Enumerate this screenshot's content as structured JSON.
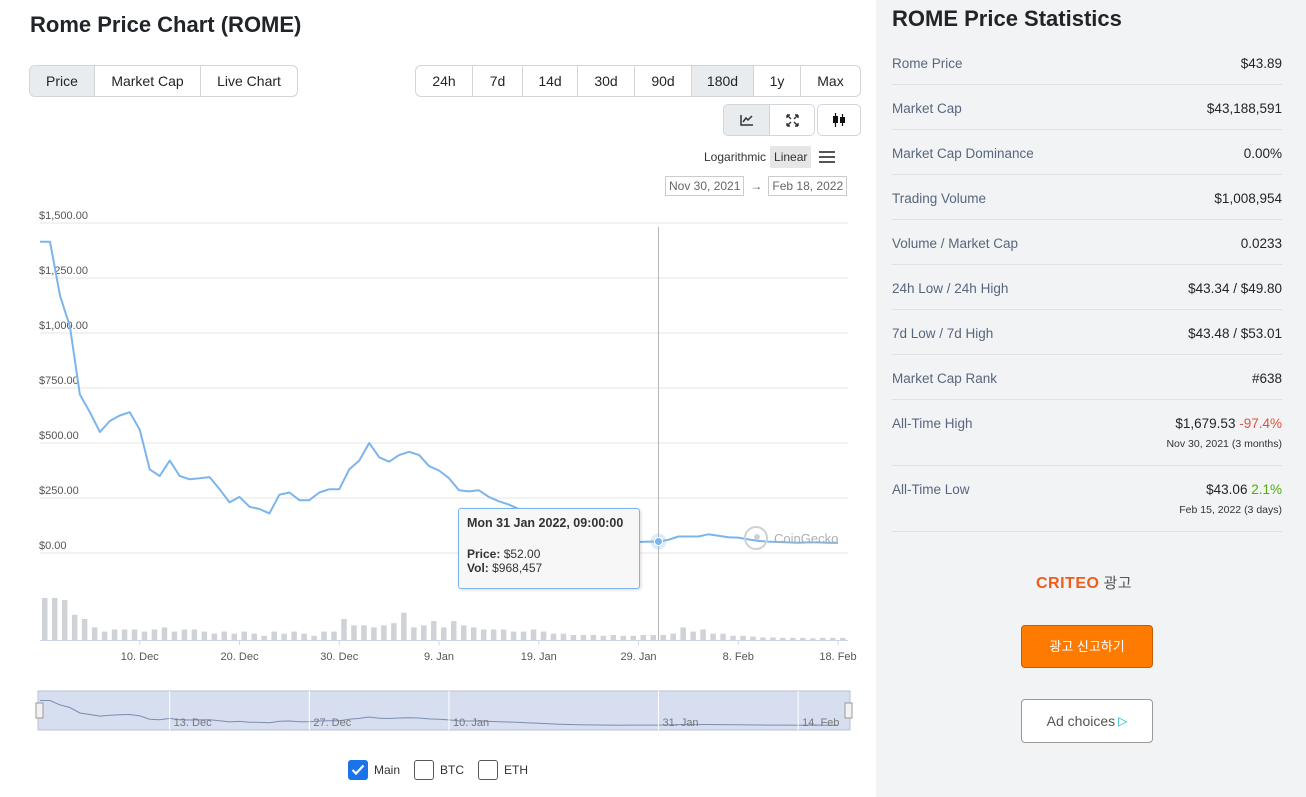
{
  "page_title": "Rome Price Chart (ROME)",
  "chart_type_tabs": [
    {
      "label": "Price",
      "active": true
    },
    {
      "label": "Market Cap",
      "active": false
    },
    {
      "label": "Live Chart",
      "active": false
    }
  ],
  "time_range_tabs": [
    {
      "label": "24h",
      "active": false
    },
    {
      "label": "7d",
      "active": false
    },
    {
      "label": "14d",
      "active": false
    },
    {
      "label": "30d",
      "active": false
    },
    {
      "label": "90d",
      "active": false
    },
    {
      "label": "180d",
      "active": true
    },
    {
      "label": "1y",
      "active": false
    },
    {
      "label": "Max",
      "active": false
    }
  ],
  "view_tools": [
    {
      "icon": "line-chart-icon",
      "active": true
    },
    {
      "icon": "expand-icon",
      "active": false
    },
    {
      "icon": "candlestick-icon",
      "active": false
    }
  ],
  "scale": {
    "log_label": "Logarithmic",
    "linear_label": "Linear",
    "active": "Linear"
  },
  "date_range": {
    "from": "Nov 30, 2021",
    "arrow": "→",
    "to": "Feb 18, 2022"
  },
  "tooltip": {
    "header": "Mon 31 Jan 2022, 09:00:00",
    "price_label": "Price:",
    "price_value": "$52.00",
    "vol_label": "Vol:",
    "vol_value": "$968,457"
  },
  "watermark": "CoinGecko",
  "navigator_labels": [
    "13. Dec",
    "27. Dec",
    "10. Jan",
    "31. Jan",
    "14. Feb"
  ],
  "series_toggles": [
    {
      "label": "Main",
      "checked": true
    },
    {
      "label": "BTC",
      "checked": false
    },
    {
      "label": "ETH",
      "checked": false
    }
  ],
  "colors": {
    "line": "#7cb5ec",
    "volume": "#cfd2d6",
    "navigator_fill": "#d7def0",
    "accent_orange": "#fe7b00",
    "criteo_orange": "#f45a1c",
    "negative": "#e15241",
    "positive": "#4eaf0a",
    "checkbox_blue": "#1a73e8"
  },
  "chart_data": {
    "type": "line",
    "y_ticks": [
      "$1,500.00",
      "$1,250.00",
      "$1,000.00",
      "$750.00",
      "$500.00",
      "$250.00",
      "$0.00"
    ],
    "ylim": [
      0,
      1500
    ],
    "x_ticks": [
      "10. Dec",
      "20. Dec",
      "30. Dec",
      "9. Jan",
      "19. Jan",
      "29. Jan",
      "8. Feb",
      "18. Feb"
    ],
    "x_range": [
      "2021-11-30",
      "2022-02-19"
    ],
    "grid": true,
    "crosshair_x": "2022-01-31",
    "series": [
      {
        "x": [
          "2021-11-30",
          "2021-12-01",
          "2021-12-02",
          "2021-12-03",
          "2021-12-04",
          "2021-12-05",
          "2021-12-06",
          "2021-12-07",
          "2021-12-08",
          "2021-12-09",
          "2021-12-10",
          "2021-12-11",
          "2021-12-12",
          "2021-12-13",
          "2021-12-14",
          "2021-12-15",
          "2021-12-16",
          "2021-12-17",
          "2021-12-18",
          "2021-12-19",
          "2021-12-20",
          "2021-12-21",
          "2021-12-22",
          "2021-12-23",
          "2021-12-24",
          "2021-12-25",
          "2021-12-26",
          "2021-12-27",
          "2021-12-28",
          "2021-12-29",
          "2021-12-30",
          "2021-12-31",
          "2022-01-01",
          "2022-01-02",
          "2022-01-03",
          "2022-01-04",
          "2022-01-05",
          "2022-01-06",
          "2022-01-07",
          "2022-01-08",
          "2022-01-09",
          "2022-01-10",
          "2022-01-11",
          "2022-01-12",
          "2022-01-13",
          "2022-01-14",
          "2022-01-15",
          "2022-01-16",
          "2022-01-17",
          "2022-01-18",
          "2022-01-19",
          "2022-01-20",
          "2022-01-21",
          "2022-01-22",
          "2022-01-23",
          "2022-01-24",
          "2022-01-25",
          "2022-01-26",
          "2022-01-27",
          "2022-01-28",
          "2022-01-29",
          "2022-01-30",
          "2022-01-31",
          "2022-02-01",
          "2022-02-02",
          "2022-02-03",
          "2022-02-04",
          "2022-02-05",
          "2022-02-06",
          "2022-02-07",
          "2022-02-08",
          "2022-02-09",
          "2022-02-10",
          "2022-02-11",
          "2022-02-12",
          "2022-02-13",
          "2022-02-14",
          "2022-02-15",
          "2022-02-16",
          "2022-02-17",
          "2022-02-18"
        ],
        "y": [
          1415,
          1415,
          1170,
          1030,
          720,
          640,
          550,
          600,
          625,
          640,
          560,
          380,
          350,
          420,
          350,
          335,
          340,
          345,
          290,
          230,
          255,
          210,
          200,
          180,
          265,
          275,
          240,
          240,
          275,
          290,
          290,
          380,
          420,
          500,
          435,
          415,
          445,
          460,
          445,
          395,
          375,
          340,
          285,
          280,
          285,
          255,
          235,
          220,
          200,
          175,
          150,
          120,
          100,
          85,
          70,
          62,
          55,
          50,
          46,
          48,
          50,
          52,
          52,
          60,
          75,
          75,
          75,
          85,
          78,
          72,
          70,
          62,
          55,
          52,
          50,
          48,
          47,
          48,
          48,
          47,
          46
        ]
      }
    ],
    "volume": {
      "x": [
        "2021-11-30",
        "2021-12-01",
        "2021-12-02",
        "2021-12-03",
        "2021-12-04",
        "2021-12-05",
        "2021-12-06",
        "2021-12-07",
        "2021-12-08",
        "2021-12-09",
        "2021-12-10",
        "2021-12-11",
        "2021-12-12",
        "2021-12-13",
        "2021-12-14",
        "2021-12-15",
        "2021-12-16",
        "2021-12-17",
        "2021-12-18",
        "2021-12-19",
        "2021-12-20",
        "2021-12-21",
        "2021-12-22",
        "2021-12-23",
        "2021-12-24",
        "2021-12-25",
        "2021-12-26",
        "2021-12-27",
        "2021-12-28",
        "2021-12-29",
        "2021-12-30",
        "2021-12-31",
        "2022-01-01",
        "2022-01-02",
        "2022-01-03",
        "2022-01-04",
        "2022-01-05",
        "2022-01-06",
        "2022-01-07",
        "2022-01-08",
        "2022-01-09",
        "2022-01-10",
        "2022-01-11",
        "2022-01-12",
        "2022-01-13",
        "2022-01-14",
        "2022-01-15",
        "2022-01-16",
        "2022-01-17",
        "2022-01-18",
        "2022-01-19",
        "2022-01-20",
        "2022-01-21",
        "2022-01-22",
        "2022-01-23",
        "2022-01-24",
        "2022-01-25",
        "2022-01-26",
        "2022-01-27",
        "2022-01-28",
        "2022-01-29",
        "2022-01-30",
        "2022-01-31",
        "2022-02-01",
        "2022-02-02",
        "2022-02-03",
        "2022-02-04",
        "2022-02-05",
        "2022-02-06",
        "2022-02-07",
        "2022-02-08",
        "2022-02-09",
        "2022-02-10",
        "2022-02-11",
        "2022-02-12",
        "2022-02-13",
        "2022-02-14",
        "2022-02-15",
        "2022-02-16",
        "2022-02-17",
        "2022-02-18"
      ],
      "y": [
        1.0,
        1.0,
        0.95,
        0.6,
        0.5,
        0.3,
        0.2,
        0.25,
        0.25,
        0.25,
        0.2,
        0.25,
        0.3,
        0.2,
        0.25,
        0.25,
        0.2,
        0.15,
        0.2,
        0.15,
        0.2,
        0.15,
        0.1,
        0.2,
        0.15,
        0.2,
        0.15,
        0.1,
        0.2,
        0.2,
        0.5,
        0.35,
        0.35,
        0.3,
        0.35,
        0.4,
        0.65,
        0.3,
        0.35,
        0.45,
        0.3,
        0.45,
        0.35,
        0.3,
        0.25,
        0.25,
        0.25,
        0.2,
        0.2,
        0.25,
        0.2,
        0.15,
        0.15,
        0.12,
        0.12,
        0.12,
        0.1,
        0.12,
        0.1,
        0.1,
        0.12,
        0.12,
        0.12,
        0.15,
        0.3,
        0.2,
        0.25,
        0.15,
        0.15,
        0.1,
        0.1,
        0.08,
        0.06,
        0.06,
        0.05,
        0.05,
        0.05,
        0.04,
        0.05,
        0.05,
        0.05
      ]
    }
  },
  "stats": {
    "title": "ROME Price Statistics",
    "rows": [
      {
        "label": "Rome Price",
        "value": "$43.89"
      },
      {
        "label": "Market Cap",
        "value": "$43,188,591"
      },
      {
        "label": "Market Cap Dominance",
        "value": "0.00%"
      },
      {
        "label": "Trading Volume",
        "value": "$1,008,954"
      },
      {
        "label": "Volume / Market Cap",
        "value": "0.0233"
      },
      {
        "label": "24h Low / 24h High",
        "value": "$43.34 / $49.80"
      },
      {
        "label": "7d Low / 7d High",
        "value": "$43.48 / $53.01"
      },
      {
        "label": "Market Cap Rank",
        "value": "#638"
      }
    ],
    "ath": {
      "label": "All-Time High",
      "value": "$1,679.53",
      "change": "-97.4%",
      "date": "Nov 30, 2021 (3 months)"
    },
    "atl": {
      "label": "All-Time Low",
      "value": "$43.06",
      "change": "2.1%",
      "date": "Feb 15, 2022 (3 days)"
    }
  },
  "ad": {
    "brand": "CRITEO",
    "ad_word": "광고",
    "report_button": "광고 신고하기",
    "ad_choices": "Ad choices"
  }
}
